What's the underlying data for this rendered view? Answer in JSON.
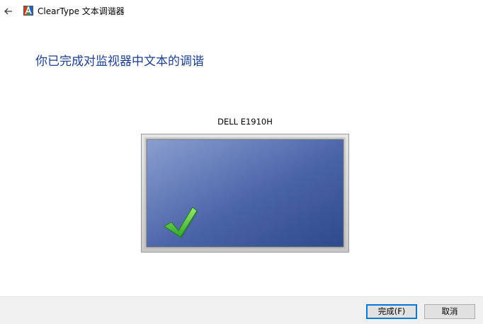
{
  "window": {
    "title": "ClearType 文本调谐器"
  },
  "main": {
    "heading": "你已完成对监视器中文本的调谐",
    "monitor_name": "DELL E1910H"
  },
  "footer": {
    "finish_label": "完成(F)",
    "cancel_label": "取消"
  },
  "colors": {
    "heading": "#1e3f8a",
    "accent": "#0078d7",
    "screen_dark": "#2f4a8a",
    "screen_light": "#8a9fd0",
    "checkmark": "#3fbf2f"
  }
}
